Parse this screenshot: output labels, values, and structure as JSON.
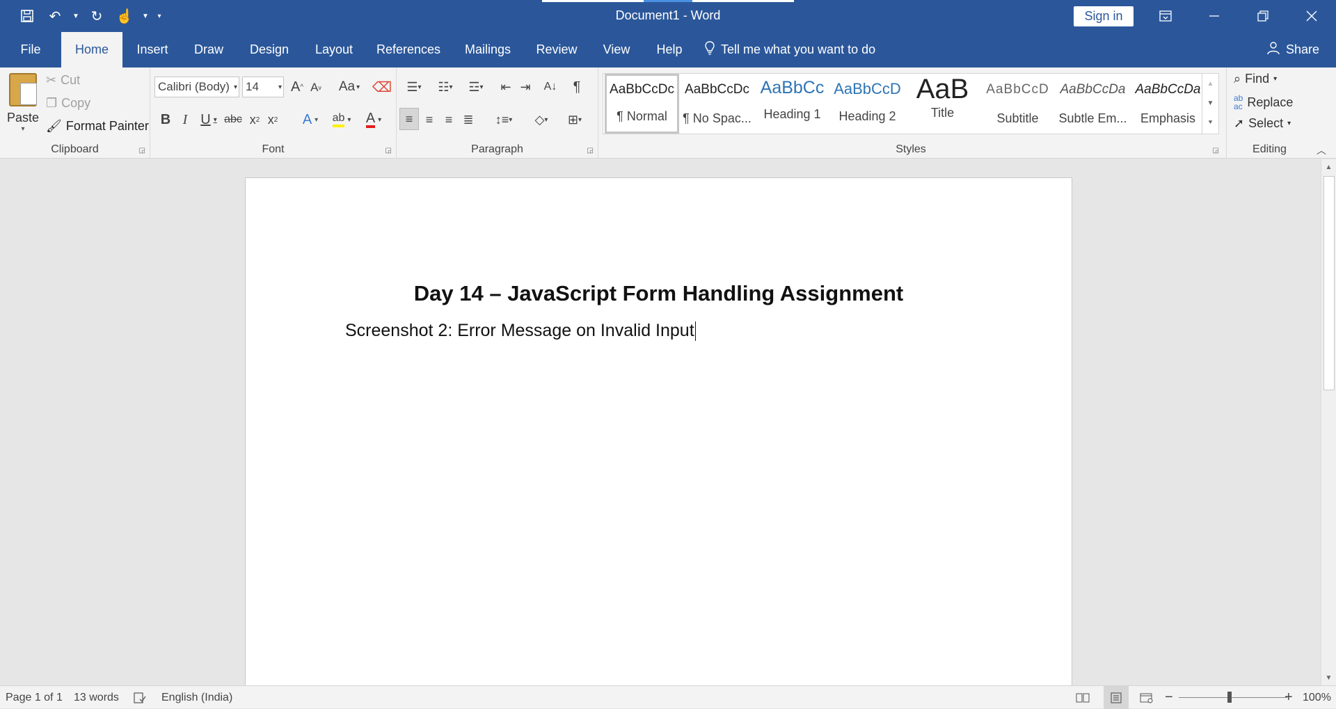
{
  "titlebar": {
    "document_name": "Document1",
    "separator": "-",
    "app_name": "Word",
    "sign_in": "Sign in"
  },
  "tabs": [
    {
      "label": "File"
    },
    {
      "label": "Home"
    },
    {
      "label": "Insert"
    },
    {
      "label": "Draw"
    },
    {
      "label": "Design"
    },
    {
      "label": "Layout"
    },
    {
      "label": "References"
    },
    {
      "label": "Mailings"
    },
    {
      "label": "Review"
    },
    {
      "label": "View"
    },
    {
      "label": "Help"
    }
  ],
  "tell_me": "Tell me what you want to do",
  "share": "Share",
  "clipboard": {
    "paste": "Paste",
    "cut": "Cut",
    "copy": "Copy",
    "format_painter": "Format Painter",
    "label": "Clipboard"
  },
  "font": {
    "name": "Calibri (Body)",
    "size": "14",
    "change_case": "Aa",
    "label": "Font"
  },
  "paragraph": {
    "label": "Paragraph"
  },
  "styles": {
    "label": "Styles",
    "items": [
      {
        "sample": "AaBbCcDc",
        "name": "¶ Normal"
      },
      {
        "sample": "AaBbCcDc",
        "name": "¶ No Spac..."
      },
      {
        "sample": "AaBbCc",
        "name": "Heading 1"
      },
      {
        "sample": "AaBbCcD",
        "name": "Heading 2"
      },
      {
        "sample": "AaB",
        "name": "Title"
      },
      {
        "sample": "AaBbCcD",
        "name": "Subtitle"
      },
      {
        "sample": "AaBbCcDa",
        "name": "Subtle Em..."
      },
      {
        "sample": "AaBbCcDa",
        "name": "Emphasis"
      }
    ]
  },
  "editing": {
    "find": "Find",
    "replace": "Replace",
    "select": "Select",
    "label": "Editing"
  },
  "document": {
    "heading": "Day 14 – JavaScript Form Handling Assignment",
    "paragraph": "Screenshot 2: Error Message on Invalid Input"
  },
  "status": {
    "page": "Page 1 of 1",
    "words": "13 words",
    "language": "English (India)",
    "zoom": "100%"
  },
  "colors": {
    "brand": "#2b579a",
    "ribbon": "#f3f3f3",
    "canvas": "#e6e6e6"
  }
}
